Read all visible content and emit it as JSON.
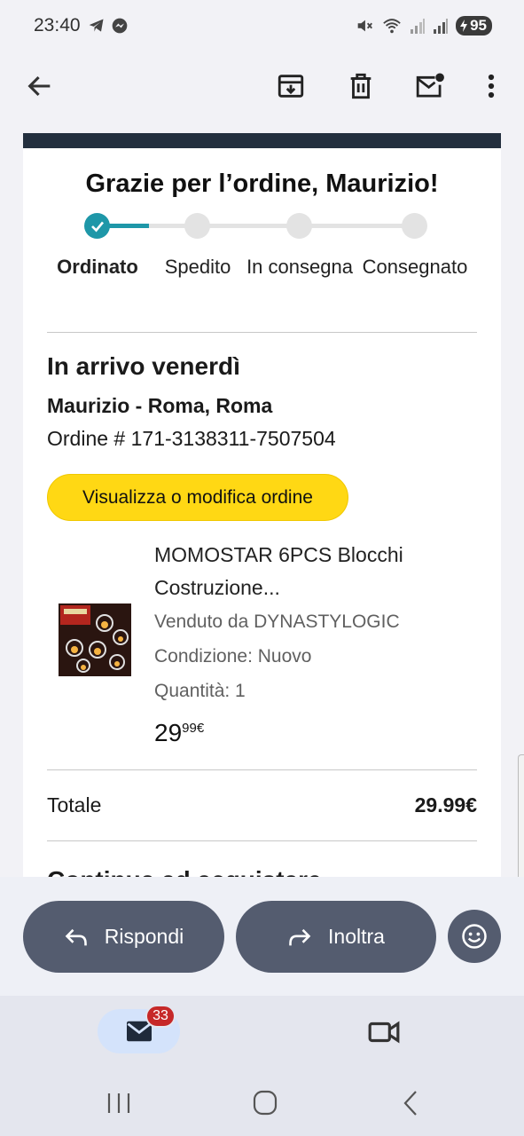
{
  "status_bar": {
    "time": "23:40",
    "battery": "95",
    "icons": [
      "telegram-icon",
      "messenger-icon",
      "mute-icon",
      "wifi-icon",
      "signal-icon",
      "signal-icon",
      "battery-icon"
    ]
  },
  "app_bar": {
    "icons": [
      "back-arrow-icon",
      "archive-icon",
      "delete-icon",
      "mark-unread-icon",
      "more-vert-icon"
    ]
  },
  "email": {
    "title": "Grazie per l’ordine, Maurizio!",
    "steps": [
      {
        "label": "Ordinato",
        "done": true
      },
      {
        "label": "Spedito",
        "done": false
      },
      {
        "label": "In consegna",
        "done": false
      },
      {
        "label": "Consegnato",
        "done": false
      }
    ],
    "arriving": "In arrivo venerdì",
    "address": "Maurizio - Roma, Roma",
    "order_number": "Ordine # 171-3138311-7507504",
    "view_button": "Visualizza o modifica ordine",
    "product": {
      "name": "MOMOSTAR 6PCS Blocchi Costruzione...",
      "seller": "Venduto da DYNASTYLOGIC",
      "condition": "Condizione: Nuovo",
      "quantity": "Quantità: 1",
      "price_main": "29",
      "price_fraction": "99€"
    },
    "total_label": "Totale",
    "total_value": "29.99€",
    "cut_off_heading": "Continua ad acquistare"
  },
  "actions": {
    "reply": "Rispondi",
    "forward": "Inoltra"
  },
  "bottom_nav": {
    "mail_badge": "33"
  },
  "colors": {
    "accent_teal": "#1e97a8",
    "button_yellow": "#ffd814",
    "header_dark": "#232f3e",
    "action_pill": "#545c6f",
    "badge_red": "#c62828"
  }
}
